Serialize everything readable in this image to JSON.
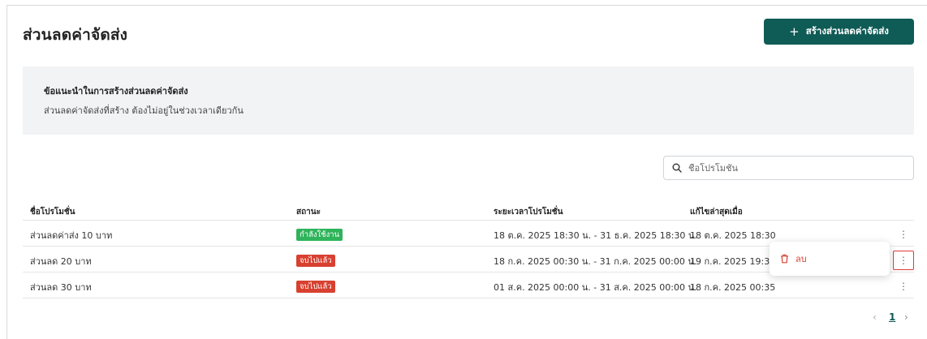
{
  "header": {
    "title": "ส่วนลดค่าจัดส่ง",
    "create_button": {
      "icon": "plus-icon",
      "label": "สร้างส่วนลดค่าจัดส่ง"
    }
  },
  "tip": {
    "title": "ข้อแนะนำในการสร้างส่วนลดค่าจัดส่ง",
    "body": "ส่วนลดค่าจัดส่งที่สร้าง ต้องไม่อยู่ในช่วงเวลาเดียวกัน"
  },
  "search": {
    "icon": "search-icon",
    "placeholder": "ชื่อโปรโมชั่น",
    "value": ""
  },
  "table": {
    "columns": [
      "ชื่อโปรโมชั่น",
      "สถานะ",
      "ระยะเวลาโปรโมชั่น",
      "แก้ไขล่าสุดเมื่อ"
    ],
    "rows": [
      {
        "name": "ส่วนลดค่าส่ง 10 บาท",
        "status": "กำลังใช้งาน",
        "status_color": "#2fb35b",
        "period": "18 ต.ค. 2025 18:30 น. - 31 ธ.ค. 2025 18:30 น.",
        "updated": "18 ต.ค. 2025 18:30"
      },
      {
        "name": "ส่วนลด 20 บาท",
        "status": "จบไปแล้ว",
        "status_color": "#d84030",
        "period": "18 ก.ค. 2025 00:30 น. - 31 ก.ค. 2025 00:00 น.",
        "updated": "19 ก.ค. 2025 19:37"
      },
      {
        "name": "ส่วนลด 30 บาท",
        "status": "จบไปแล้ว",
        "status_color": "#d84030",
        "period": "01 ส.ค. 2025 00:00 น. - 31 ส.ค. 2025 00:00 น.",
        "updated": "18 ก.ค. 2025 00:35"
      }
    ]
  },
  "row_menu": {
    "icon": "trash-icon",
    "delete_label": "ลบ"
  },
  "pagination": {
    "prev": "‹",
    "current": "1",
    "next": "›"
  },
  "colors": {
    "primary": "#0f5b56",
    "active": "#2fb35b",
    "ended": "#d84030",
    "tip_bg": "#f2f3f5"
  }
}
